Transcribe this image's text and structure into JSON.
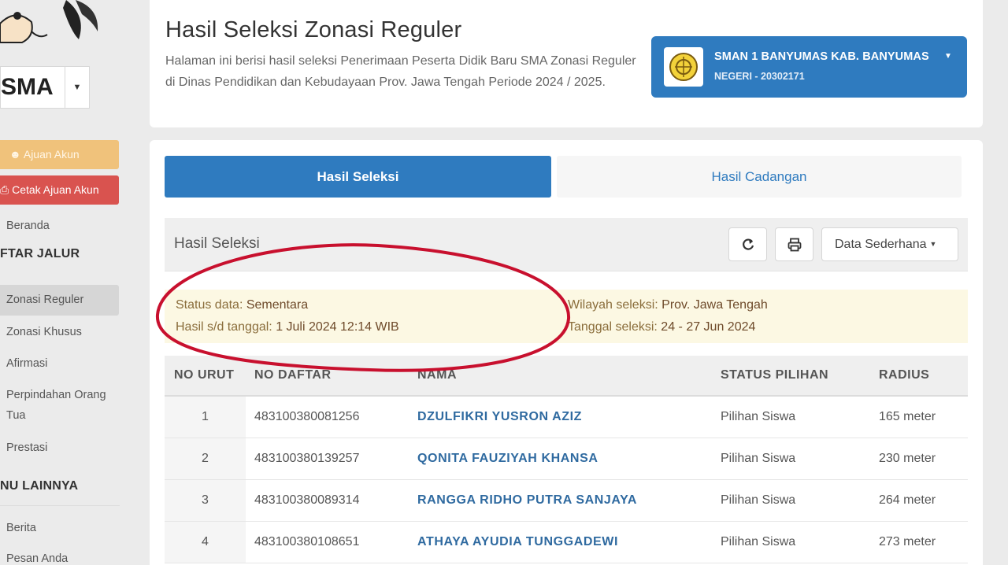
{
  "sidebar": {
    "level_label": "SMA",
    "buttons": {
      "ajuan": "Ajuan Akun",
      "cetak": "Cetak Ajuan Akun"
    },
    "beranda": "Beranda",
    "section_jalur": "FTAR JALUR",
    "jalur_items": [
      {
        "label": "Zonasi Reguler",
        "active": true
      },
      {
        "label": "Zonasi Khusus"
      },
      {
        "label": "Afirmasi"
      },
      {
        "label": "Perpindahan Orang Tua"
      },
      {
        "label": "Prestasi"
      }
    ],
    "section_lainnya": "NU LAINNYA",
    "lainnya_items": [
      {
        "label": "Berita"
      },
      {
        "label": "Pesan Anda"
      }
    ]
  },
  "header": {
    "title": "Hasil Seleksi Zonasi Reguler",
    "description": "Halaman ini berisi hasil seleksi Penerimaan Peserta Didik Baru SMA Zonasi Reguler di Dinas Pendidikan dan Kebudayaan Prov. Jawa Tengah Periode 2024 / 2025.",
    "school": {
      "name": "SMAN 1 BANYUMAS KAB. BANYUMAS",
      "sub": "NEGERI - 20302171"
    }
  },
  "tabs": {
    "active": "Hasil Seleksi",
    "inactive": "Hasil Cadangan"
  },
  "panel": {
    "title": "Hasil Seleksi",
    "dropdown_label": "Data Sederhana"
  },
  "status": {
    "status_key": "Status data: ",
    "status_val": "Sementara",
    "hasil_key": "Hasil s/d tanggal: ",
    "hasil_val": "1 Juli 2024 12:14 WIB",
    "wilayah_key": "Wilayah seleksi: ",
    "wilayah_val": "Prov. Jawa Tengah",
    "tanggal_key": "Tanggal seleksi: ",
    "tanggal_val": "24 - 27 Jun 2024"
  },
  "table": {
    "headers": {
      "no_urut": "NO URUT",
      "no_daftar": "NO DAFTAR",
      "nama": "NAMA",
      "status_pilihan": "STATUS PILIHAN",
      "radius": "RADIUS"
    },
    "rows": [
      {
        "no": "1",
        "daftar": "483100380081256",
        "nama": "DZULFIKRI YUSRON AZIZ",
        "status": "Pilihan Siswa",
        "radius": "165 meter"
      },
      {
        "no": "2",
        "daftar": "483100380139257",
        "nama": "QONITA FAUZIYAH KHANSA",
        "status": "Pilihan Siswa",
        "radius": "230 meter"
      },
      {
        "no": "3",
        "daftar": "483100380089314",
        "nama": "RANGGA RIDHO PUTRA SANJAYA",
        "status": "Pilihan Siswa",
        "radius": "264 meter"
      },
      {
        "no": "4",
        "daftar": "483100380108651",
        "nama": "ATHAYA AYUDIA TUNGGADEWI",
        "status": "Pilihan Siswa",
        "radius": "273 meter"
      }
    ]
  },
  "colors": {
    "primary": "#2f7bbf",
    "warning_bg": "#fcf8e3",
    "annotation": "#c8102e"
  }
}
